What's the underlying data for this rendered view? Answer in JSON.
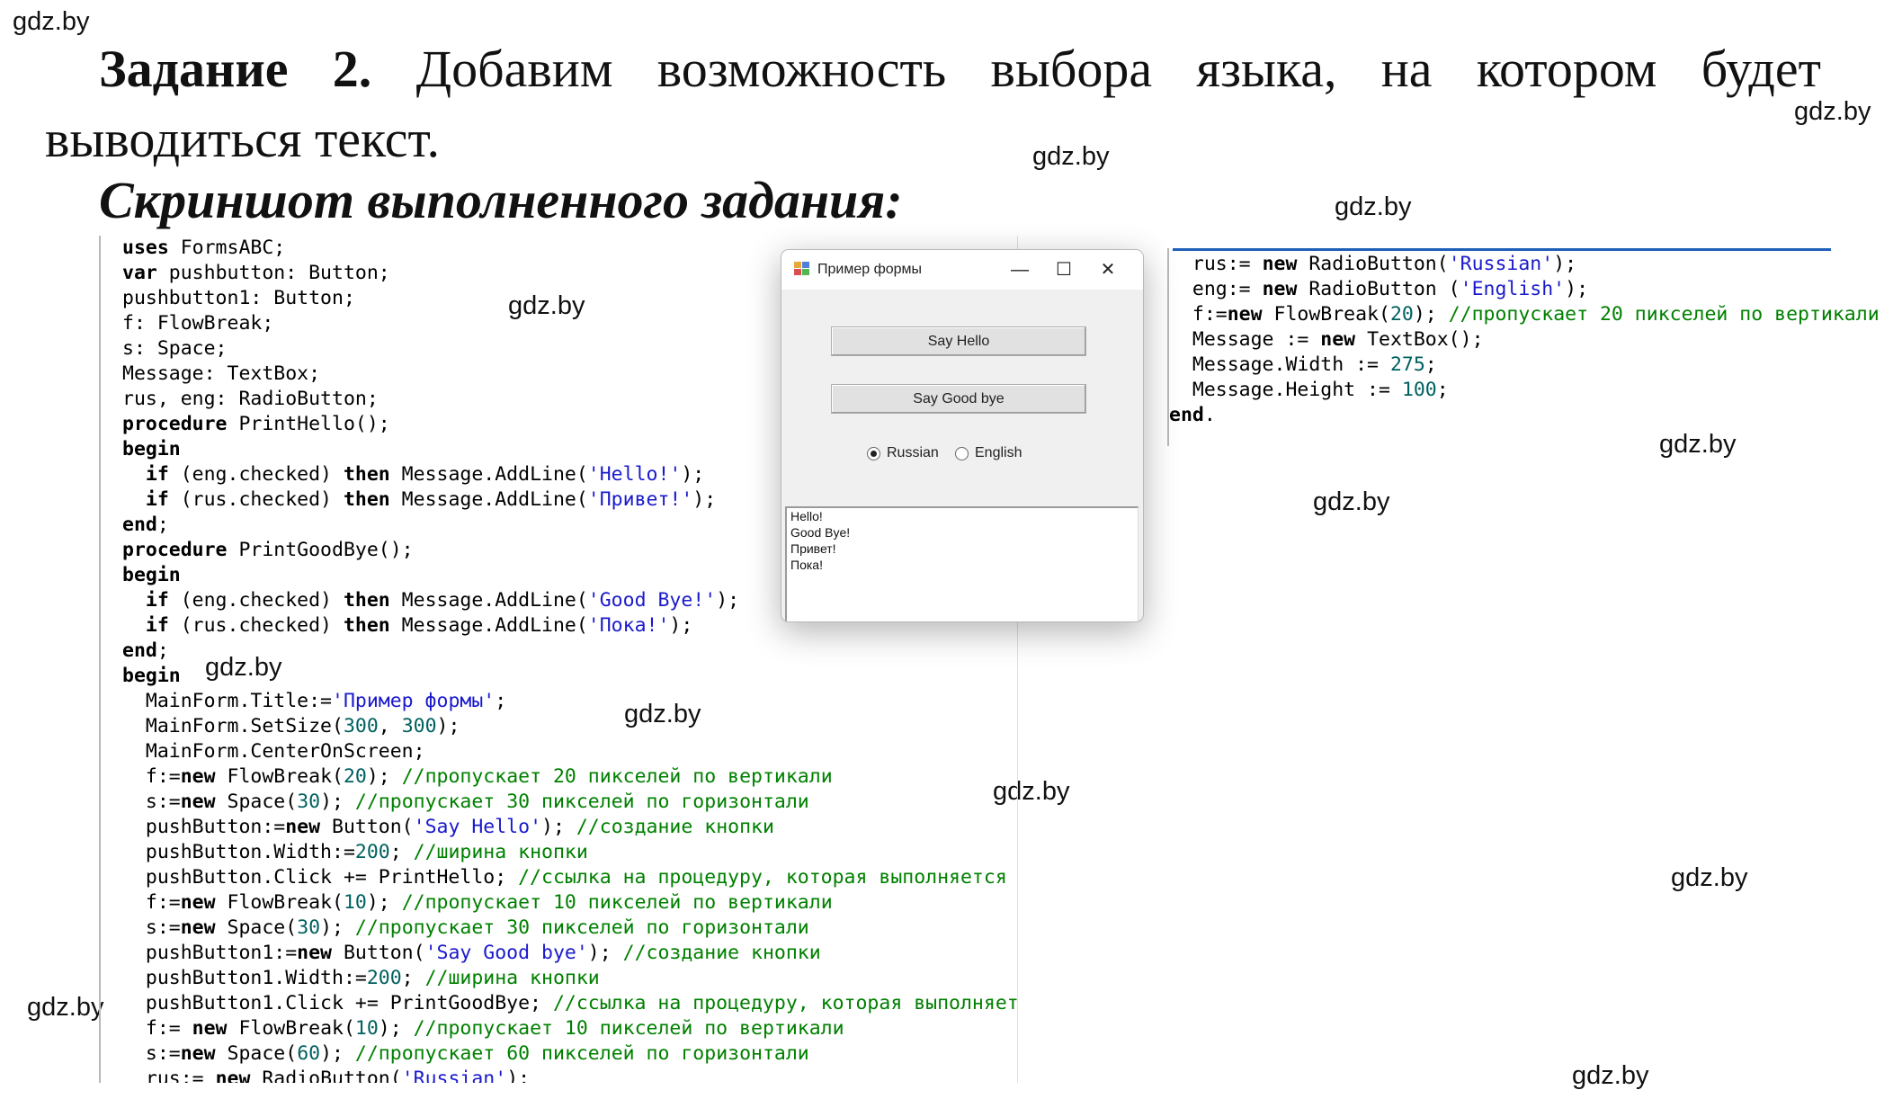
{
  "watermarks": [
    "gdz.by",
    "gdz.by",
    "gdz.by",
    "gdz.by",
    "gdz.by",
    "gdz.by",
    "gdz.by",
    "gdz.by",
    "gdz.by",
    "gdz.by",
    "gdz.by",
    "gdz.by",
    "gdz.by",
    "gdz.by",
    "gdz.by",
    "gdz.by"
  ],
  "task": {
    "label": "Задание 2.",
    "text_line1": "Добавим возможность выбора языка, на котором будет",
    "text_line2": "выводиться текст."
  },
  "screenshot_caption": "Скриншот выполненного задания:",
  "code_main": [
    "uses FormsABC;",
    "var pushbutton: Button;",
    "pushbutton1: Button;",
    "f: FlowBreak;",
    "s: Space;",
    "Message: TextBox;",
    "rus, eng: RadioButton;",
    "procedure PrintHello();",
    "begin",
    "  if (eng.checked) then Message.AddLine('Hello!');",
    "  if (rus.checked) then Message.AddLine('Привет!');",
    "end;",
    "procedure PrintGoodBye();",
    "begin",
    "  if (eng.checked) then Message.AddLine('Good Bye!');",
    "  if (rus.checked) then Message.AddLine('Пока!');",
    "end;",
    "begin",
    "  MainForm.Title:='Пример формы';",
    "  MainForm.SetSize(300, 300);",
    "  MainForm.CenterOnScreen;",
    "  f:=new FlowBreak(20); //пропускает 20 пикселей по вертикали",
    "  s:=new Space(30); //пропускает 30 пикселей по горизонтали",
    "  pushButton:=new Button('Say Hello'); //создание кнопки",
    "  pushButton.Width:=200; //ширина кнопки",
    "  pushButton.Click += PrintHello; //ссылка на процедуру, которая выполняется при нажатии на кнопку",
    "  f:=new FlowBreak(10); //пропускает 10 пикселей по вертикали",
    "  s:=new Space(30); //пропускает 30 пикселей по горизонтали",
    "  pushButton1:=new Button('Say Good bye'); //создание кнопки",
    "  pushButton1.Width:=200; //ширина кнопки",
    "  pushButton1.Click += PrintGoodBye; //ссылка на процедуру, которая выполняется при нажатии на кнопку",
    "  f:= new FlowBreak(10); //пропускает 10 пикселей по вертикали",
    "  s:=new Space(60); //пропускает 60 пикселей по горизонтали",
    "  rus:= new RadioButton('Russian');"
  ],
  "code_right": [
    "  rus:= new RadioButton('Russian');",
    "  eng:= new RadioButton ('English');",
    "  f:=new FlowBreak(20); //пропускает 20 пикселей по вертикали",
    "  Message := new TextBox();",
    "  Message.Width := 275;",
    "  Message.Height := 100;",
    "end."
  ],
  "form_window": {
    "title": "Пример формы",
    "controls": {
      "minimize": "—",
      "maximize": "☐",
      "close": "✕"
    },
    "button_hello": "Say Hello",
    "button_goodbye": "Say Good bye",
    "radio_russian": "Russian",
    "radio_english": "English",
    "radio_selected": "Russian",
    "textbox_lines": [
      "Hello!",
      "Good Bye!",
      "Привет!",
      "Пока!"
    ]
  }
}
